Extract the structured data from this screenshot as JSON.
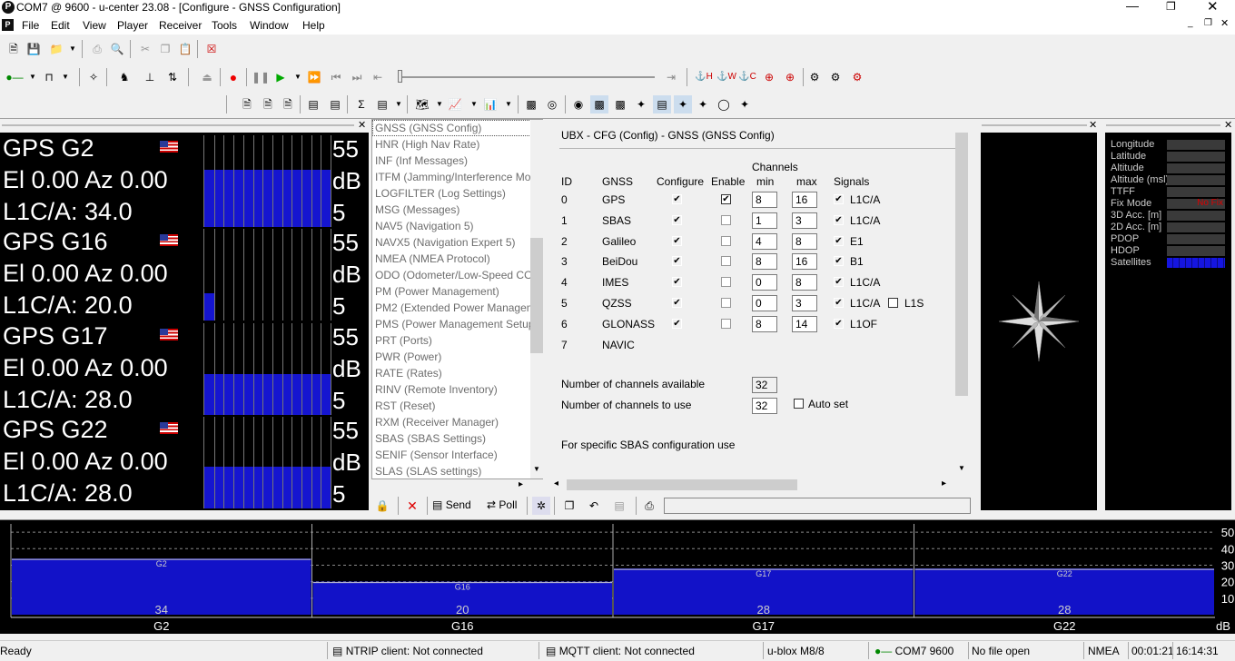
{
  "window": {
    "title": "COM7 @ 9600 - u-center 23.08 - [Configure - GNSS Configuration]"
  },
  "menu": [
    "File",
    "Edit",
    "View",
    "Player",
    "Receiver",
    "Tools",
    "Window",
    "Help"
  ],
  "satellites": [
    {
      "name": "GPS G2",
      "elaz": "El 0.00 Az 0.00",
      "signal": "L1C/A: 34.0",
      "top": "55",
      "mid": "dB",
      "bot": "5",
      "level": 0.62
    },
    {
      "name": "GPS G16",
      "elaz": "El 0.00 Az 0.00",
      "signal": "L1C/A: 20.0",
      "top": "55",
      "mid": "dB",
      "bot": "5",
      "level": 0.3
    },
    {
      "name": "GPS G17",
      "elaz": "El 0.00 Az 0.00",
      "signal": "L1C/A: 28.0",
      "top": "55",
      "mid": "dB",
      "bot": "5",
      "level": 0.45
    },
    {
      "name": "GPS G22",
      "elaz": "El 0.00 Az 0.00",
      "signal": "L1C/A: 28.0",
      "top": "55",
      "mid": "dB",
      "bot": "5",
      "level": 0.46
    }
  ],
  "messages": [
    "GNSS (GNSS Config)",
    "HNR (High Nav Rate)",
    "INF (Inf Messages)",
    "ITFM (Jamming/Interference Mo",
    "LOGFILTER (Log Settings)",
    "MSG (Messages)",
    "NAV5 (Navigation 5)",
    "NAVX5 (Navigation Expert 5)",
    "NMEA (NMEA Protocol)",
    "ODO (Odometer/Low-Speed CO",
    "PM (Power Management)",
    "PM2 (Extended Power Managem",
    "PMS (Power Management Setup",
    "PRT (Ports)",
    "PWR (Power)",
    "RATE (Rates)",
    "RINV (Remote Inventory)",
    "RST (Reset)",
    "RXM (Receiver Manager)",
    "SBAS (SBAS Settings)",
    "SENIF (Sensor Interface)",
    "SLAS (SLAS settings)"
  ],
  "config": {
    "heading": "UBX - CFG (Config) - GNSS (GNSS Config)",
    "col_id": "ID",
    "col_gnss": "GNSS",
    "col_configure": "Configure",
    "col_enable": "Enable",
    "col_channels": "Channels",
    "col_min": "min",
    "col_max": "max",
    "col_signals": "Signals",
    "rows": [
      {
        "id": "0",
        "gnss": "GPS",
        "configure": true,
        "enable": true,
        "min": "8",
        "max": "16",
        "sig": "L1C/A",
        "sig2": ""
      },
      {
        "id": "1",
        "gnss": "SBAS",
        "configure": true,
        "enable": false,
        "min": "1",
        "max": "3",
        "sig": "L1C/A",
        "sig2": ""
      },
      {
        "id": "2",
        "gnss": "Galileo",
        "configure": true,
        "enable": false,
        "min": "4",
        "max": "8",
        "sig": "E1",
        "sig2": ""
      },
      {
        "id": "3",
        "gnss": "BeiDou",
        "configure": true,
        "enable": false,
        "min": "8",
        "max": "16",
        "sig": "B1",
        "sig2": ""
      },
      {
        "id": "4",
        "gnss": "IMES",
        "configure": true,
        "enable": false,
        "min": "0",
        "max": "8",
        "sig": "L1C/A",
        "sig2": ""
      },
      {
        "id": "5",
        "gnss": "QZSS",
        "configure": true,
        "enable": false,
        "min": "0",
        "max": "3",
        "sig": "L1C/A",
        "sig2": "L1S"
      },
      {
        "id": "6",
        "gnss": "GLONASS",
        "configure": true,
        "enable": false,
        "min": "8",
        "max": "14",
        "sig": "L1OF",
        "sig2": ""
      },
      {
        "id": "7",
        "gnss": "NAVIC",
        "configure": false,
        "enable": false,
        "min": "",
        "max": "",
        "sig": "",
        "sig2": ""
      }
    ],
    "available_label": "Number of channels available",
    "available": "32",
    "use_label": "Number of channels to use",
    "use": "32",
    "autoset": "Auto set",
    "sbas_note": "For specific SBAS configuration use"
  },
  "cmd": {
    "send": "Send",
    "poll": "Poll"
  },
  "nav": [
    {
      "label": "Longitude",
      "value": ""
    },
    {
      "label": "Latitude",
      "value": ""
    },
    {
      "label": "Altitude",
      "value": ""
    },
    {
      "label": "Altitude (msl)",
      "value": ""
    },
    {
      "label": "TTFF",
      "value": ""
    },
    {
      "label": "Fix Mode",
      "value": "No Fix"
    },
    {
      "label": "3D Acc. [m]",
      "value": ""
    },
    {
      "label": "2D Acc. [m]",
      "value": ""
    },
    {
      "label": "PDOP",
      "value": ""
    },
    {
      "label": "HDOP",
      "value": ""
    },
    {
      "label": "Satellites",
      "value": ""
    }
  ],
  "chart_data": {
    "type": "bar",
    "categories": [
      "G2",
      "G16",
      "G17",
      "G22"
    ],
    "values": [
      34,
      20,
      28,
      28
    ],
    "inner_labels": [
      "G2",
      "G16",
      "G17",
      "G22"
    ],
    "y_ticks": [
      "50",
      "40",
      "30",
      "20",
      "10"
    ],
    "ylabel": "dB",
    "ylim": [
      0,
      55
    ],
    "colors": {
      "bar": "#1212c8",
      "bg": "#000000"
    }
  },
  "status": {
    "ready": "Ready",
    "ntrip": "NTRIP client: Not connected",
    "mqtt": "MQTT client: Not connected",
    "receiver": "u-blox M8/8",
    "port": "COM7 9600",
    "file": "No file open",
    "protocol": "NMEA",
    "elapsed": "00:01:21",
    "clock": "16:14:31"
  }
}
